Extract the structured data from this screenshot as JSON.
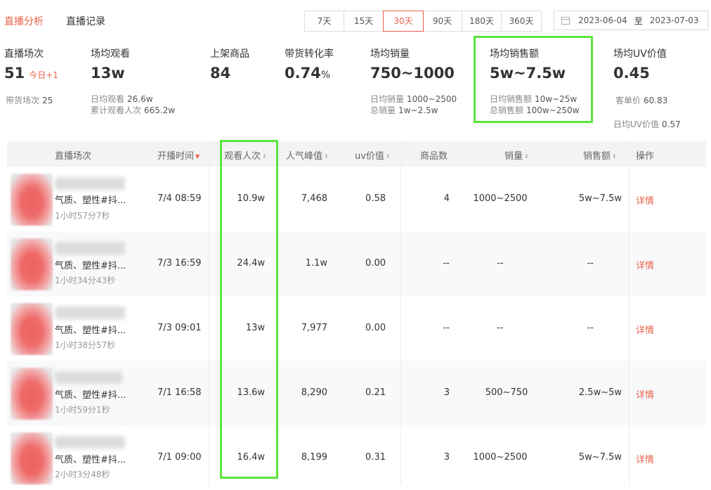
{
  "tabs": [
    {
      "label": "直播分析",
      "active": true
    },
    {
      "label": "直播记录",
      "active": false
    }
  ],
  "range": {
    "options": [
      "7天",
      "15天",
      "30天",
      "90天",
      "180天",
      "360天"
    ],
    "selected": "30天"
  },
  "date_range": {
    "start": "2023-06-04",
    "separator": "至",
    "end": "2023-07-03"
  },
  "stats": {
    "sessions": {
      "label": "直播场次",
      "value": "51",
      "today": "今日+1",
      "sub1_label": "带货场次",
      "sub1_value": "25"
    },
    "avg_views": {
      "label": "场均观看",
      "value": "13w",
      "sub1_label": "日均观看",
      "sub1_value": "26.6w",
      "sub2_label": "累计观看人次",
      "sub2_value": "665.2w"
    },
    "products": {
      "label": "上架商品",
      "value": "84"
    },
    "conversion": {
      "label": "带货转化率",
      "value": "0.74",
      "unit": "%"
    },
    "avg_sales": {
      "label": "场均销量",
      "value": "750~1000",
      "sub1_label": "日均销量",
      "sub1_value": "1000~2500",
      "sub2_label": "总销量",
      "sub2_value": "1w~2.5w"
    },
    "avg_revenue": {
      "label": "场均销售额",
      "value": "5w~7.5w",
      "sub1_label": "日均销售额",
      "sub1_value": "10w~25w",
      "sub2_label": "总销售额",
      "sub2_value": "100w~250w"
    },
    "uv": {
      "label": "场均UV价值",
      "value": "0.45",
      "sub1_label": "客单价",
      "sub1_value": "60.83",
      "sub2_label": "日均UV价值",
      "sub2_value": "0.57"
    }
  },
  "table": {
    "columns": [
      "直播场次",
      "开播时间",
      "观看人次",
      "人气峰值",
      "uv价值",
      "商品数",
      "销量",
      "销售额",
      "操作"
    ],
    "rows": [
      {
        "title": "气质、塑性#抖...",
        "duration": "1小时57分7秒",
        "start": "7/4 08:59",
        "views": "10.9w",
        "peak": "7,468",
        "uv": "0.58",
        "products": "4",
        "sales": "1000~2500",
        "revenue": "5w~7.5w",
        "action": "详情"
      },
      {
        "title": "气质、塑性#抖...",
        "duration": "1小时34分43秒",
        "start": "7/3 16:59",
        "views": "24.4w",
        "peak": "1.1w",
        "uv": "0.00",
        "products": "--",
        "sales": "--",
        "revenue": "--",
        "action": "详情"
      },
      {
        "title": "气质、塑性#抖...",
        "duration": "1小时38分57秒",
        "start": "7/3 09:01",
        "views": "13w",
        "peak": "7,977",
        "uv": "0.00",
        "products": "--",
        "sales": "--",
        "revenue": "--",
        "action": "详情"
      },
      {
        "title": "气质、塑性#抖...",
        "duration": "1小时59分1秒",
        "start": "7/1 16:58",
        "views": "13.6w",
        "peak": "8,290",
        "uv": "0.21",
        "products": "3",
        "sales": "500~750",
        "revenue": "2.5w~5w",
        "action": "详情"
      },
      {
        "title": "气质、塑性#抖...",
        "duration": "2小时3分48秒",
        "start": "7/1 09:00",
        "views": "16.4w",
        "peak": "8,199",
        "uv": "0.31",
        "products": "3",
        "sales": "1000~2500",
        "revenue": "5w~7.5w",
        "action": "详情"
      }
    ]
  },
  "colors": {
    "accent": "#e8624a",
    "highlight": "#5ce63c"
  },
  "icons": {
    "calendar": "calendar-icon",
    "sort": "sort-icon"
  }
}
